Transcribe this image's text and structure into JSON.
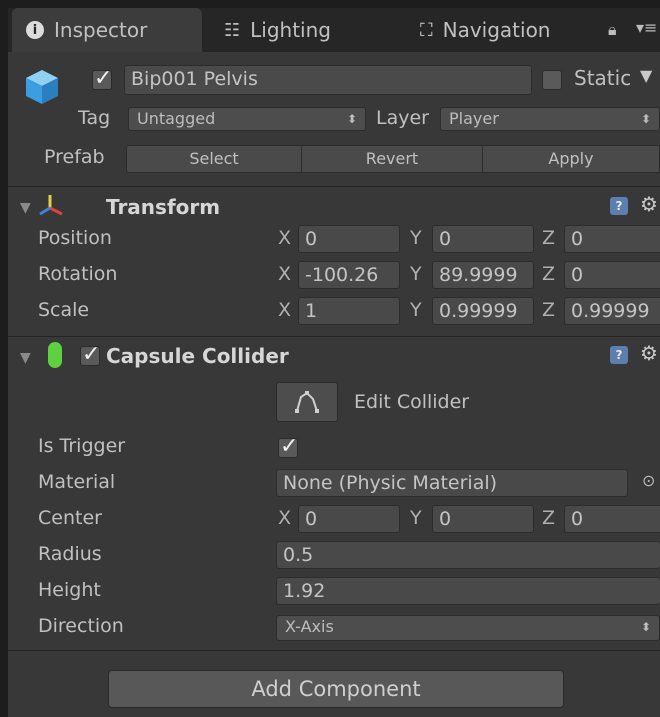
{
  "tabs": [
    {
      "label": "Inspector",
      "icon": "info-icon",
      "active": true
    },
    {
      "label": "Lighting",
      "icon": "sliders-icon",
      "active": false
    },
    {
      "label": "Navigation",
      "icon": "navigation-icon",
      "active": false
    }
  ],
  "object": {
    "active": true,
    "name": "Bip001 Pelvis",
    "static_label": "Static",
    "static_checked": false,
    "tag_label": "Tag",
    "tag_value": "Untagged",
    "layer_label": "Layer",
    "layer_value": "Player",
    "prefab_label": "Prefab",
    "prefab_buttons": [
      "Select",
      "Revert",
      "Apply"
    ]
  },
  "transform": {
    "title": "Transform",
    "position": {
      "label": "Position",
      "x": "0",
      "y": "0",
      "z": "0"
    },
    "rotation": {
      "label": "Rotation",
      "x": "-100.26",
      "y": "89.9999",
      "z": "0"
    },
    "scale": {
      "label": "Scale",
      "x": "1",
      "y": "0.99999",
      "z": "0.99999"
    }
  },
  "capsule": {
    "title": "Capsule Collider",
    "enabled": true,
    "edit_label": "Edit Collider",
    "is_trigger_label": "Is Trigger",
    "is_trigger": true,
    "material_label": "Material",
    "material_value": "None (Physic Material)",
    "center_label": "Center",
    "center": {
      "x": "0",
      "y": "0",
      "z": "0"
    },
    "radius_label": "Radius",
    "radius_value": "0.5",
    "height_label": "Height",
    "height_value": "1.92",
    "direction_label": "Direction",
    "direction_value": "X-Axis"
  },
  "axes": {
    "x": "X",
    "y": "Y",
    "z": "Z"
  },
  "add_component": "Add Component",
  "colors": {
    "panel_bg": "#383838",
    "field_bg": "#494949",
    "help_icon": "#5c7fb0"
  }
}
